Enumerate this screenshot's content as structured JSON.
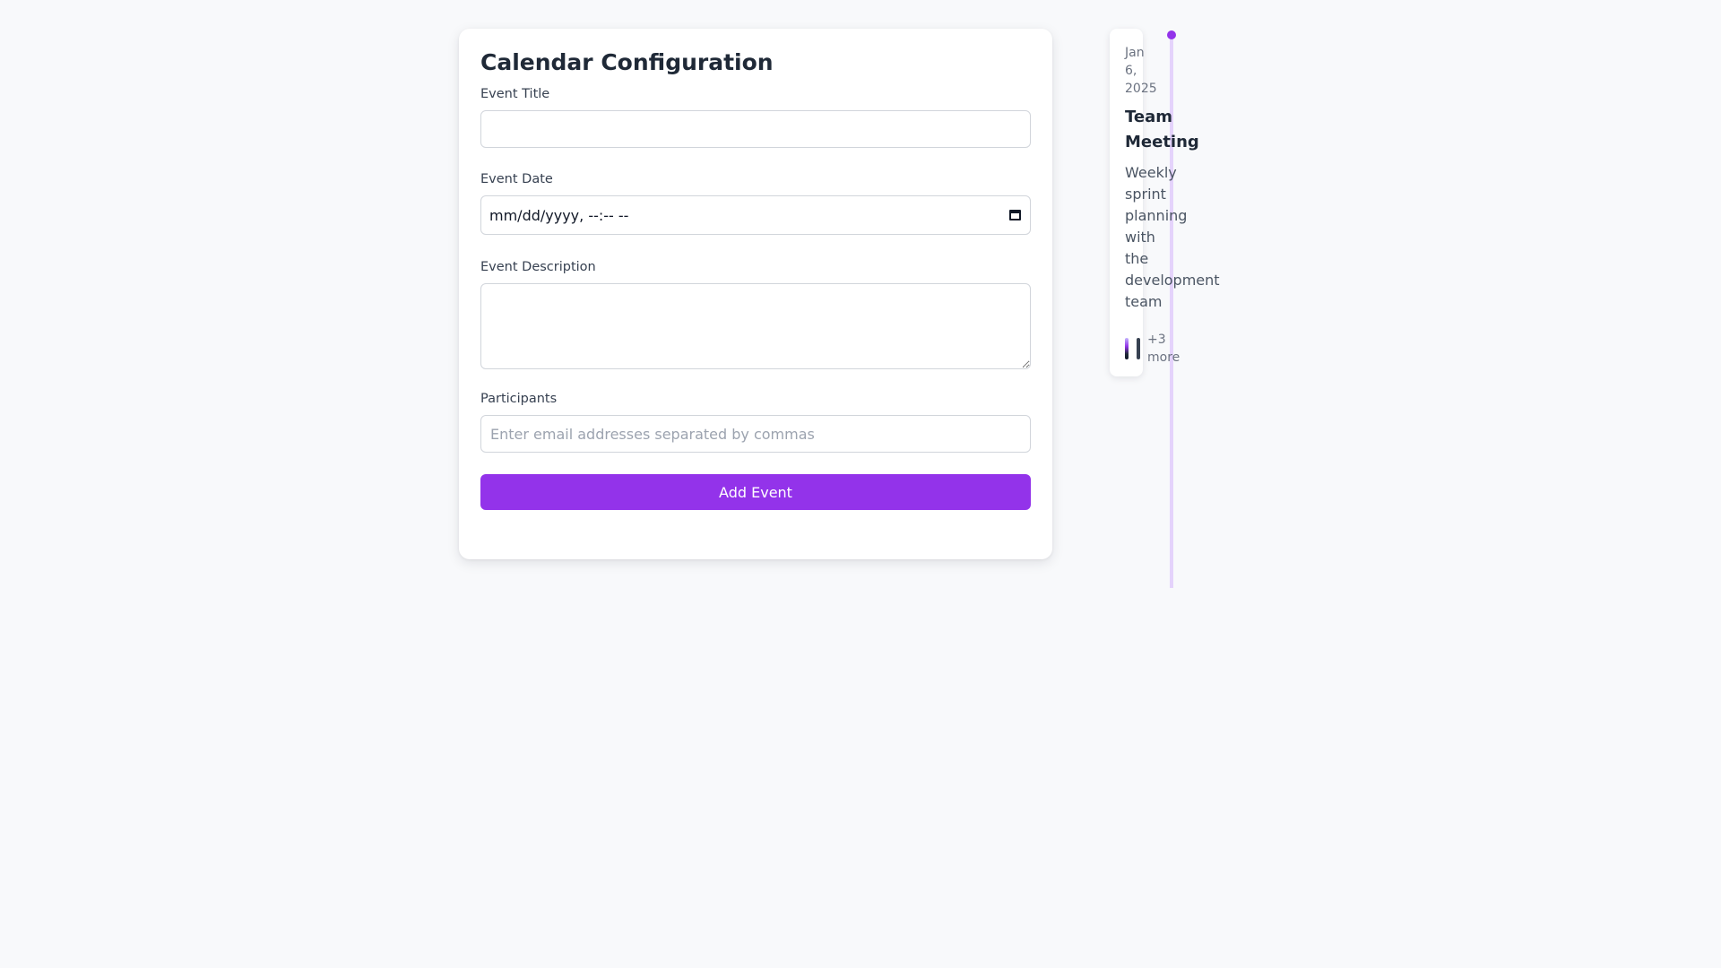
{
  "form": {
    "title": "Calendar Configuration",
    "fields": {
      "event_title": {
        "label": "Event Title",
        "value": "",
        "placeholder": ""
      },
      "event_date": {
        "label": "Event Date",
        "display": "mm/dd/yyyy, --:-- --"
      },
      "event_description": {
        "label": "Event Description",
        "value": ""
      },
      "participants": {
        "label": "Participants",
        "placeholder": "Enter email addresses separated by commas"
      }
    },
    "submit_label": "Add Event"
  },
  "timeline": {
    "event": {
      "date": "Jan 6, 2025",
      "title": "Team Meeting",
      "description": "Weekly sprint planning with the development team",
      "more_label": "+3 more"
    }
  },
  "colors": {
    "accent": "#9333ea",
    "timeline_line": "#e4d3fb",
    "background": "#f8f9fb"
  },
  "icons": {
    "date_picker": "calendar-icon"
  }
}
